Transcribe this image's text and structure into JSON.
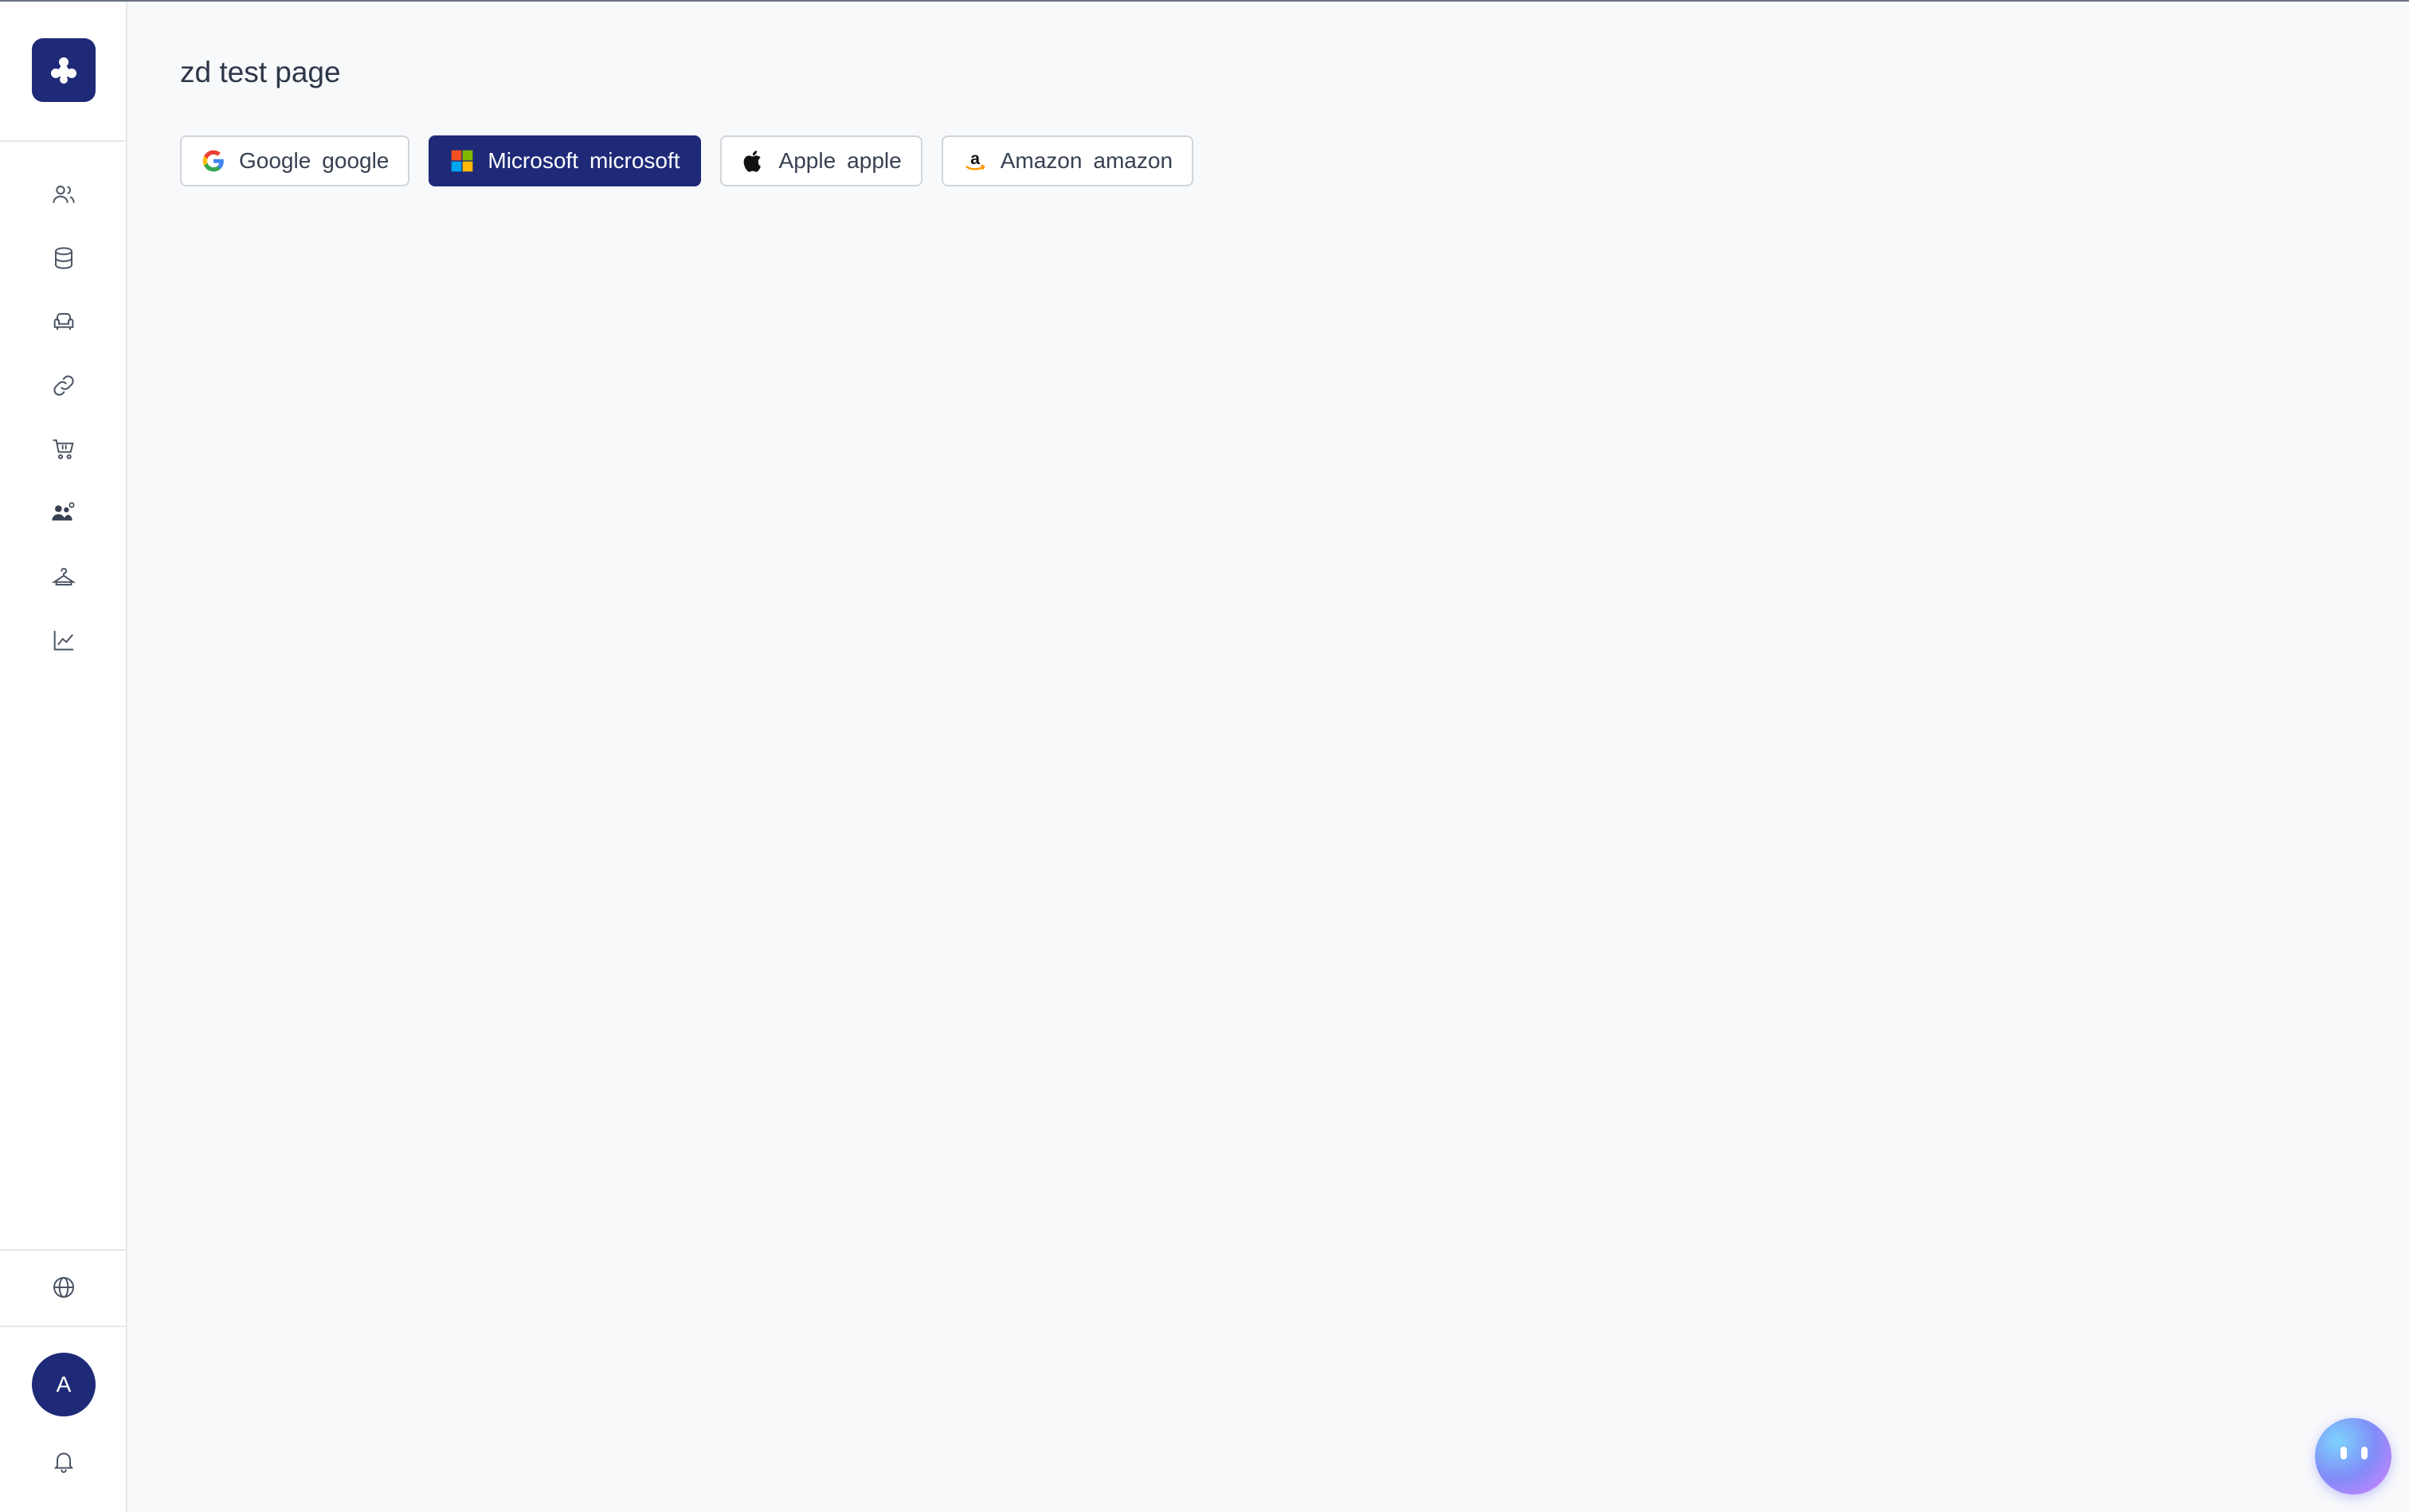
{
  "page": {
    "title": "zd test page"
  },
  "brand_buttons": [
    {
      "name": "Google",
      "value": "google",
      "icon": "google-icon",
      "selected": false
    },
    {
      "name": "Microsoft",
      "value": "microsoft",
      "icon": "microsoft-icon",
      "selected": true
    },
    {
      "name": "Apple",
      "value": "apple",
      "icon": "apple-icon",
      "selected": false
    },
    {
      "name": "Amazon",
      "value": "amazon",
      "icon": "amazon-icon",
      "selected": false
    }
  ],
  "sidebar": {
    "logo_icon": "app-logo-icon",
    "items": [
      {
        "icon": "users-icon"
      },
      {
        "icon": "database-icon"
      },
      {
        "icon": "armchair-icon"
      },
      {
        "icon": "link-icon"
      },
      {
        "icon": "shopping-cart-icon"
      },
      {
        "icon": "user-group-icon"
      },
      {
        "icon": "hanger-icon"
      },
      {
        "icon": "line-chart-icon"
      }
    ],
    "language_icon": "globe-icon",
    "avatar_initial": "A",
    "notification_icon": "bell-icon"
  },
  "colors": {
    "primary": "#1e2a78",
    "background": "#f8f9fb",
    "border": "#d1d5db"
  }
}
